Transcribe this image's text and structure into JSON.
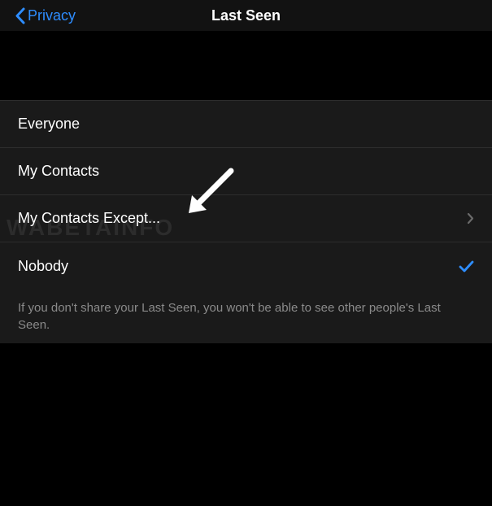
{
  "header": {
    "back_label": "Privacy",
    "title": "Last Seen"
  },
  "options": [
    {
      "label": "Everyone",
      "selected": false,
      "disclosure": false
    },
    {
      "label": "My Contacts",
      "selected": false,
      "disclosure": false
    },
    {
      "label": "My Contacts Except...",
      "selected": false,
      "disclosure": true
    },
    {
      "label": "Nobody",
      "selected": true,
      "disclosure": false
    }
  ],
  "footer_text": "If you don't share your Last Seen, you won't be able to see other people's Last Seen.",
  "watermark": "WABETAINFO",
  "colors": {
    "accent": "#2e8dff",
    "background": "#000000",
    "row_bg": "#1a1a1a",
    "separator": "#2d2d2d",
    "secondary_text": "#8a8a8a"
  }
}
